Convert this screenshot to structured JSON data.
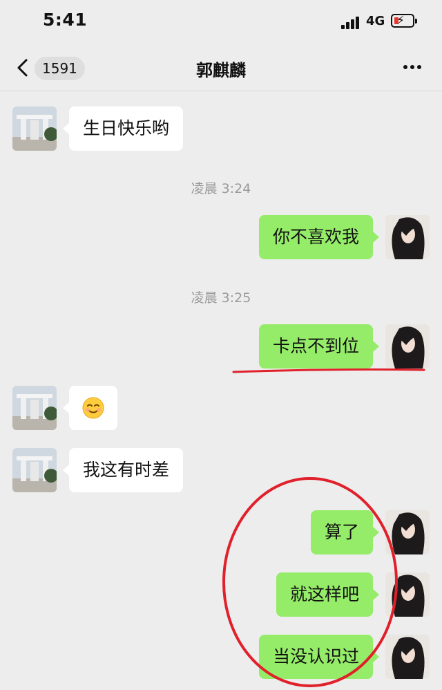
{
  "status_bar": {
    "time": "5:41",
    "network": "4G"
  },
  "nav": {
    "unread_count": "1591",
    "title": "郭麒麟"
  },
  "messages": [
    {
      "type": "text",
      "side": "in",
      "text": "生日快乐哟"
    },
    {
      "type": "time",
      "text": "凌晨 3:24"
    },
    {
      "type": "text",
      "side": "out",
      "text": "你不喜欢我"
    },
    {
      "type": "time",
      "text": "凌晨 3:25"
    },
    {
      "type": "text",
      "side": "out",
      "text": "卡点不到位"
    },
    {
      "type": "emoji",
      "side": "in",
      "text": "☺️"
    },
    {
      "type": "text",
      "side": "in",
      "text": "我这有时差"
    },
    {
      "type": "text",
      "side": "out",
      "text": "算了"
    },
    {
      "type": "text",
      "side": "out",
      "text": "就这样吧"
    },
    {
      "type": "text",
      "side": "out",
      "text": "当没认识过"
    }
  ],
  "annotations": {
    "color": "#e0202a"
  },
  "colors": {
    "outgoing_bubble": "#95ec69",
    "incoming_bubble": "#ffffff",
    "background": "#ededed"
  }
}
